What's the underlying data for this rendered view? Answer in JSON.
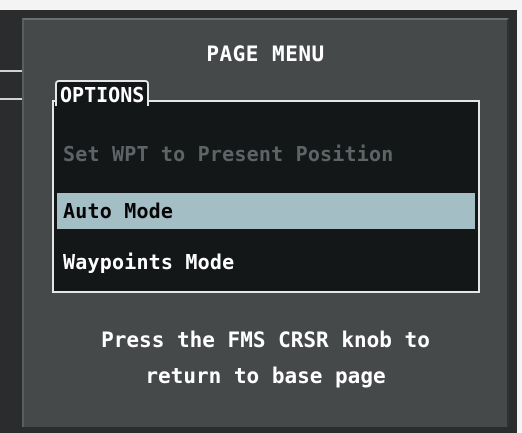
{
  "dialog": {
    "title": "PAGE MENU",
    "options_label": "OPTIONS",
    "items": [
      {
        "label": "Set WPT to Present Position",
        "state": "disabled"
      },
      {
        "label": "Auto Mode",
        "state": "selected"
      },
      {
        "label": "Waypoints Mode",
        "state": "enabled"
      }
    ],
    "instruction_line1": "Press the FMS CRSR knob to",
    "instruction_line2": "return to base page"
  },
  "colors": {
    "panel": "#46494a",
    "list_background": "#131718",
    "selection_highlight": "#a4bec6",
    "disabled_text": "#5e6466",
    "text": "#ffffff"
  }
}
